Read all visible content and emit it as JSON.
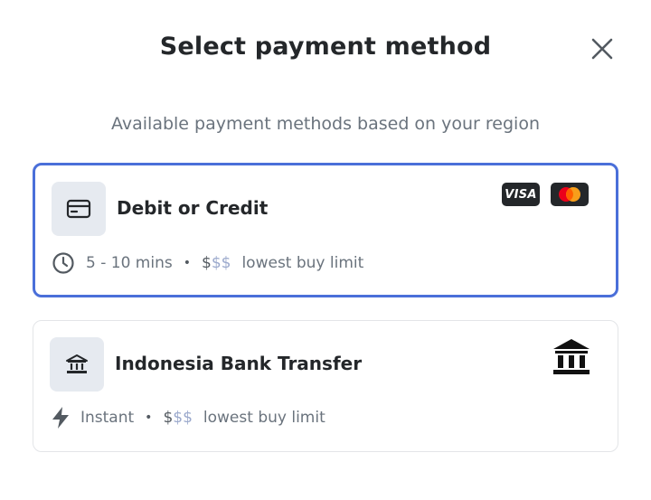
{
  "modal": {
    "title": "Select payment method",
    "subtitle": "Available payment methods based on your region",
    "close_icon": "close-icon"
  },
  "methods": [
    {
      "name": "Debit or Credit",
      "icon": "credit-card-icon",
      "selected": true,
      "speed_icon": "clock-icon",
      "speed": "5 - 10 mins",
      "price_dark": "$",
      "price_light": "$$",
      "limit": "lowest buy limit",
      "brands": [
        "VISA",
        "mastercard"
      ]
    },
    {
      "name": "Indonesia Bank Transfer",
      "icon": "bank-icon",
      "selected": false,
      "speed_icon": "lightning-icon",
      "speed": "Instant",
      "price_dark": "$",
      "price_light": "$$",
      "limit": "lowest buy limit",
      "brands": [
        "bank"
      ]
    }
  ],
  "colors": {
    "selected_border": "#4a6fd9",
    "card_border": "#e3e5e8",
    "text_primary": "#24272a",
    "text_muted": "#6a737d",
    "tile_bg": "#e6eaf0",
    "price_light": "#9ba9cc"
  }
}
